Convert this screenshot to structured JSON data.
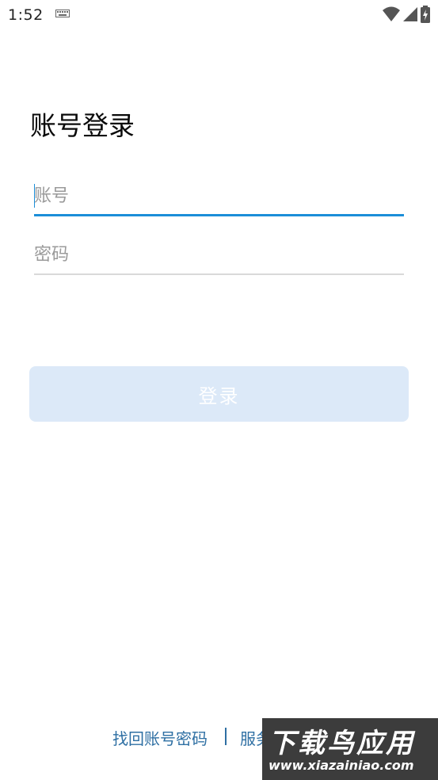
{
  "status_bar": {
    "time": "1:52",
    "icons": [
      "keyboard-icon",
      "wifi-icon",
      "signal-icon",
      "battery-charging-icon"
    ]
  },
  "page": {
    "title": "账号登录"
  },
  "form": {
    "account_placeholder": "账号",
    "password_placeholder": "密码",
    "login_label": "登录"
  },
  "footer": {
    "retrieve_label": "找回账号密码",
    "divider": "|",
    "service_label": "服务"
  },
  "watermark": {
    "main": "下载鸟应用",
    "url": "www.xiazainiao.com"
  },
  "colors": {
    "accent": "#1b8ed8",
    "button_disabled": "#dce9f8",
    "link": "#2e6fa3"
  }
}
